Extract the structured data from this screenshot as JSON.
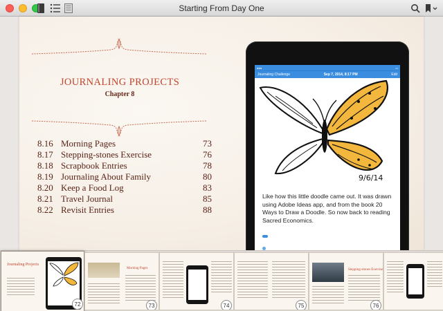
{
  "window": {
    "title": "Starting From Day One"
  },
  "toolbar": {
    "icons": [
      "library-icon",
      "contents-list-icon",
      "page-view-icon",
      "search-icon",
      "bookmark-icon"
    ]
  },
  "page": {
    "chapter_title": "JOURNALING PROJECTS",
    "chapter_subtitle": "Chapter 8",
    "toc": [
      {
        "num": "8.16",
        "title": "Morning Pages",
        "page": "73"
      },
      {
        "num": "8.17",
        "title": "Stepping-stones Exercise",
        "page": "76"
      },
      {
        "num": "8.18",
        "title": "Scrapbook Entries",
        "page": "78"
      },
      {
        "num": "8.19",
        "title": "Journaling About Family",
        "page": "80"
      },
      {
        "num": "8.20",
        "title": "Keep a Food Log",
        "page": "83"
      },
      {
        "num": "8.21",
        "title": "Travel Journal",
        "page": "85"
      },
      {
        "num": "8.22",
        "title": "Revisit Entries",
        "page": "88"
      }
    ]
  },
  "ipad": {
    "nav_left": "Journaling Challenge",
    "nav_center": "Sep 7, 2014, 8:17 PM",
    "nav_right": "Edit",
    "entry_text": "Like how this little doodle came out. It was drawn using Adobe Ideas app, and from the book 20 Ways to Draw a Doodle. So now back to reading Sacred Economics.",
    "doodle_date": "9/6/14"
  },
  "strip": {
    "thumbnails": [
      {
        "title": "Journaling Projects",
        "page": "72"
      },
      {
        "title": "Morning Pages",
        "page": "73"
      },
      {
        "title": "",
        "page": "74"
      },
      {
        "title": "",
        "page": "75"
      },
      {
        "title": "Stepping-stones Exercise",
        "page": "76"
      }
    ]
  },
  "colors": {
    "accent_red": "#c0462e",
    "toc_brown": "#5a2418",
    "dayone_blue": "#3b8de0",
    "butterfly_yellow": "#f2b73c"
  }
}
